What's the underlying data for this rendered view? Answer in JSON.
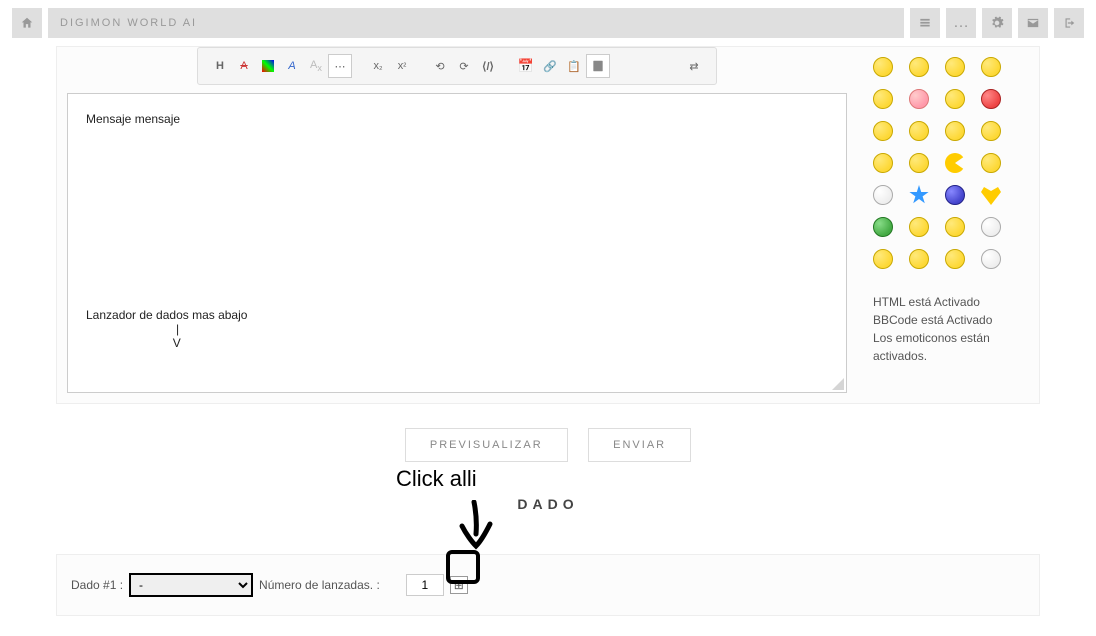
{
  "header": {
    "breadcrumb": "DIGIMON WORLD AI"
  },
  "toolbar_icons": {
    "switch": "⇄"
  },
  "editor": {
    "content": "Mensaje mensaje\n\n\n\n\n\n\n\n\n\n\n\n\n\nLanzador de dados mas abajo\n                           |\n                          V"
  },
  "emoji": {
    "status_lines": [
      "HTML está Activado",
      "BBCode está Activado",
      "Los emoticonos están activados."
    ]
  },
  "actions": {
    "preview": "PREVISUALIZAR",
    "send": "ENVIAR"
  },
  "annotation": {
    "click_text": "Click alli"
  },
  "dice": {
    "heading": "DADO",
    "label_num": "Dado #1 :",
    "select_value": "-",
    "throws_label": "Número de lanzadas. :",
    "throws_value": "1",
    "plus": "⊞"
  }
}
